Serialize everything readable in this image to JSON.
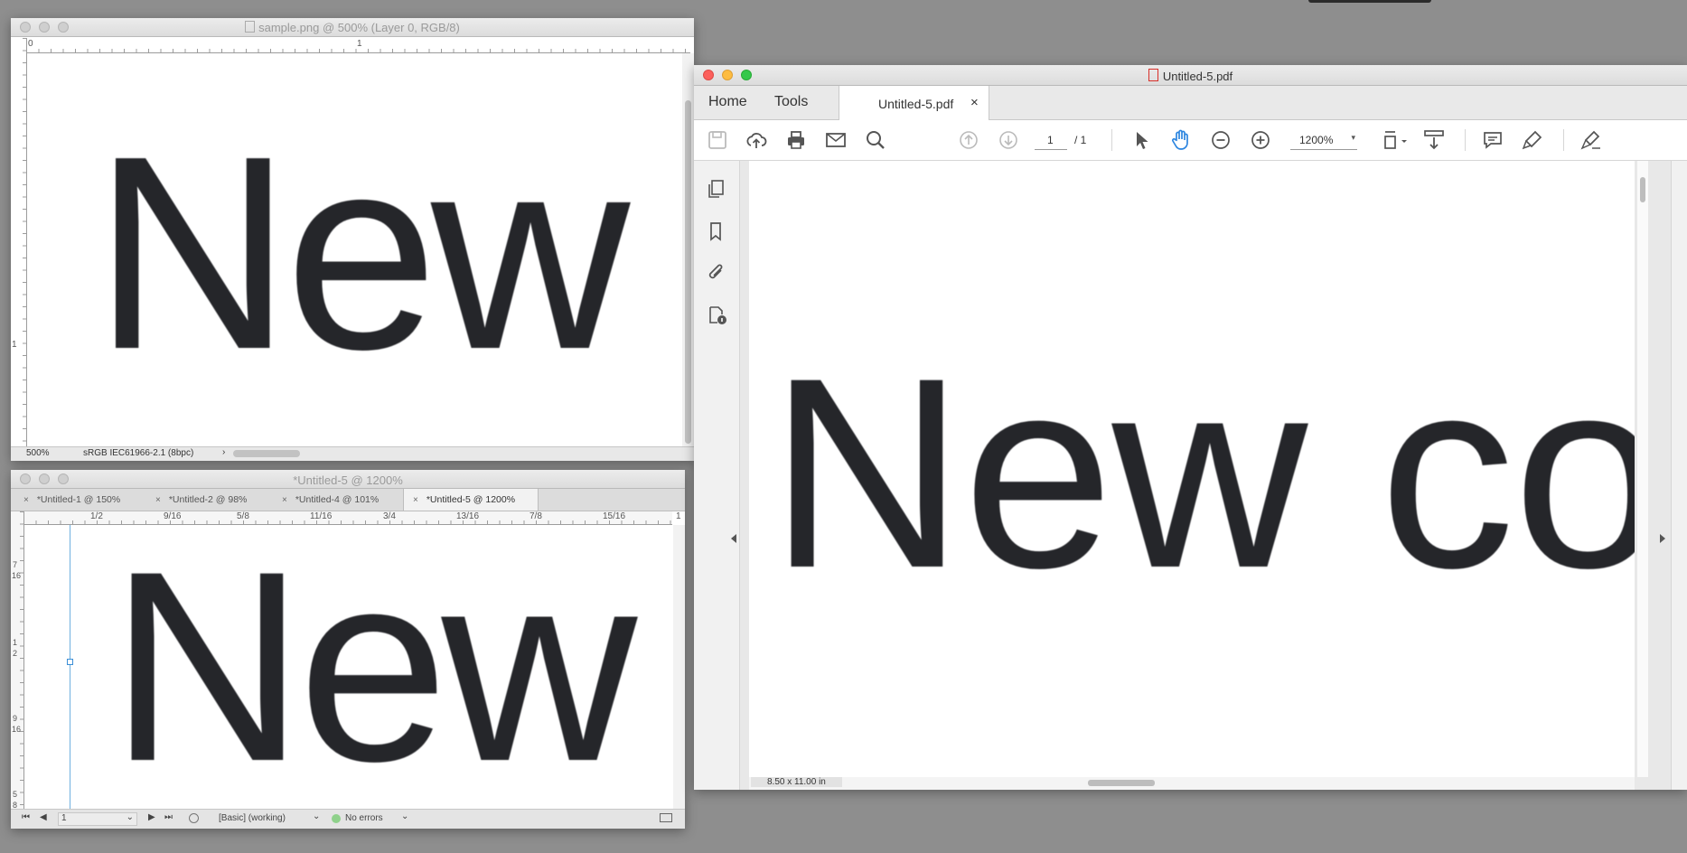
{
  "photoshop": {
    "title": "sample.png @ 500% (Layer 0, RGB/8)",
    "ruler_h_labels": [
      "0",
      "1"
    ],
    "ruler_v_labels": [
      "1"
    ],
    "canvas_text": "New",
    "zoom": "500%",
    "color_profile": "sRGB IEC61966-2.1 (8bpc)",
    "status_arrow": "›"
  },
  "indesign": {
    "title": "*Untitled-5 @ 1200%",
    "tabs": [
      {
        "label": "*Untitled-1 @ 150%",
        "close": "×"
      },
      {
        "label": "*Untitled-2 @ 98%",
        "close": "×"
      },
      {
        "label": "*Untitled-4 @ 101%",
        "close": "×"
      },
      {
        "label": "*Untitled-5 @ 1200%",
        "close": "×"
      }
    ],
    "ruler_h_labels": [
      "1/2",
      "9/16",
      "5/8",
      "11/16",
      "3/4",
      "13/16",
      "7/8",
      "15/16",
      "1"
    ],
    "ruler_v_labels": [
      "7",
      "16",
      "1",
      "2",
      "9",
      "16",
      "5",
      "8"
    ],
    "canvas_text": "New",
    "page_number": "1",
    "style": "[Basic] (working)",
    "preflight": "No errors",
    "preflight_color": "#8fd18b"
  },
  "acrobat": {
    "title": "Untitled-5.pdf",
    "nav_home": "Home",
    "nav_tools": "Tools",
    "doc_tab": "Untitled-5.pdf",
    "doc_tab_close": "×",
    "page_current": "1",
    "page_total": "/ 1",
    "zoom": "1200%",
    "canvas_text": "New co",
    "page_size": "8.50 x 11.00 in",
    "accent_color": "#2d86e0"
  }
}
